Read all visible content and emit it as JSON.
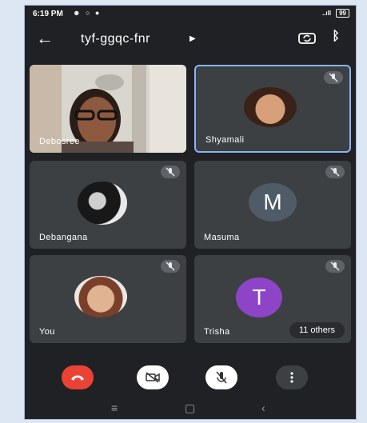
{
  "status": {
    "time": "6:19 PM",
    "battery": "99",
    "signal": "..ıll"
  },
  "header": {
    "meeting_code": "tyf-ggqc-fnr",
    "icons": [
      "back-arrow-icon",
      "chevron-right-icon",
      "switch-camera-icon",
      "bluetooth-icon"
    ]
  },
  "participants": [
    {
      "name": "Debosree",
      "muted": false,
      "display": "video"
    },
    {
      "name": "Shyamali",
      "muted": true,
      "display": "photo",
      "active_speaker": true
    },
    {
      "name": "Debangana",
      "muted": true,
      "display": "photo"
    },
    {
      "name": "Masuma",
      "muted": true,
      "display": "letter",
      "letter": "M",
      "color": "#4f5b66"
    },
    {
      "name": "You",
      "muted": true,
      "display": "photo"
    },
    {
      "name": "Trisha",
      "muted": true,
      "display": "letter",
      "letter": "T",
      "color": "#8e44c7"
    }
  ],
  "others_chip": "11 others",
  "controls": [
    {
      "name": "end-call",
      "color": "#ea4335"
    },
    {
      "name": "camera-off",
      "color": "#ffffff"
    },
    {
      "name": "mic-off",
      "color": "#ffffff"
    },
    {
      "name": "more-options",
      "color": "#3c4043"
    }
  ],
  "colors": {
    "background": "#202124",
    "tile": "#3c4043",
    "active_border": "#8ab4f8"
  }
}
